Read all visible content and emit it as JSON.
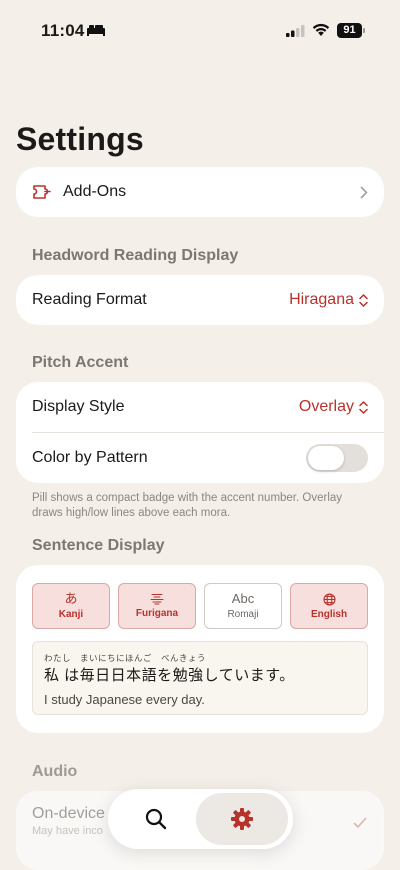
{
  "status": {
    "time": "11:04",
    "battery": "91"
  },
  "title": "Settings",
  "addons": {
    "label": "Add-Ons"
  },
  "headword": {
    "section": "Headword Reading Display",
    "reading_format_label": "Reading Format",
    "reading_format_value": "Hiragana"
  },
  "pitch": {
    "section": "Pitch Accent",
    "display_style_label": "Display Style",
    "display_style_value": "Overlay",
    "color_by_pattern_label": "Color by Pattern",
    "color_by_pattern_on": false,
    "footnote": "Pill shows a compact badge with the accent number. Overlay draws high/low lines above each mora."
  },
  "sentence": {
    "section": "Sentence Display",
    "modes": [
      {
        "glyph": "あ",
        "label": "Kanji",
        "active": true
      },
      {
        "glyph": "",
        "label": "Furigana",
        "active": true
      },
      {
        "glyph": "Abc",
        "label": "Romaji",
        "active": false
      },
      {
        "glyph": "",
        "label": "English",
        "active": true
      }
    ],
    "furigana": "わたし　まいにちにほんご　べんきょう",
    "japanese": "私 は毎日日本語を勉強しています。",
    "english": "I study Japanese every day."
  },
  "audio": {
    "section": "Audio",
    "row_label": "On-device",
    "row_subtitle": "May have inco"
  },
  "colors": {
    "accent": "#b8322c",
    "background": "#f4efe9"
  },
  "tabs": [
    "search-icon",
    "gear-icon"
  ]
}
